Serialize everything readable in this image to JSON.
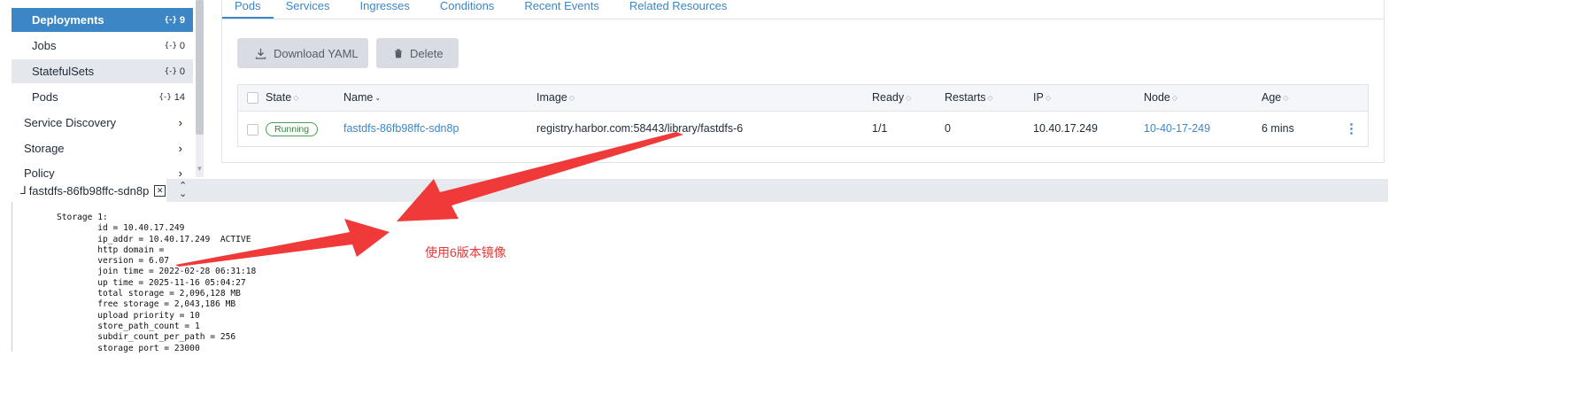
{
  "sidebar": {
    "sub_items": [
      {
        "label": "Deployments",
        "count": "9"
      },
      {
        "label": "Jobs",
        "count": "0"
      },
      {
        "label": "StatefulSets",
        "count": "0"
      },
      {
        "label": "Pods",
        "count": "14"
      }
    ],
    "groups": [
      {
        "label": "Service Discovery"
      },
      {
        "label": "Storage"
      },
      {
        "label": "Policy"
      }
    ],
    "count_icon": "{-}"
  },
  "tabs": [
    "Pods",
    "Services",
    "Ingresses",
    "Conditions",
    "Recent Events",
    "Related Resources"
  ],
  "toolbar": {
    "download_label": "Download YAML",
    "delete_label": "Delete"
  },
  "table": {
    "headers": [
      "State",
      "Name",
      "Image",
      "Ready",
      "Restarts",
      "IP",
      "Node",
      "Age"
    ],
    "rows": [
      {
        "state": "Running",
        "name": "fastdfs-86fb98ffc-sdn8p",
        "image": "registry.harbor.com:58443/library/fastdfs-6",
        "ready": "1/1",
        "restarts": "0",
        "ip": "10.40.17.249",
        "node": "10-40-17-249",
        "age": "6 mins"
      }
    ]
  },
  "terminal": {
    "tab_label": "fastdfs-86fb98ffc-sdn8p",
    "lines": [
      "Storage 1:",
      "        id = 10.40.17.249",
      "        ip_addr = 10.40.17.249  ACTIVE",
      "        http domain =",
      "        version = 6.07",
      "        join time = 2022-02-28 06:31:18",
      "        up time = 2025-11-16 05:04:27",
      "        total storage = 2,096,128 MB",
      "        free storage = 2,043,186 MB",
      "        upload priority = 10",
      "        store_path_count = 1",
      "        subdir_count_per_path = 256",
      "        storage port = 23000"
    ]
  },
  "annotation": {
    "text": "使用6版本镜像",
    "color": "#f03a3a"
  },
  "colors": {
    "accent": "#3d86c6",
    "running": "#4a9c58",
    "arrow": "#f03a3a"
  },
  "icons": [
    "download-icon",
    "trash-icon",
    "chevron-right-icon",
    "sort-icon",
    "kebab-menu-icon",
    "terminal-icon",
    "close-icon",
    "expand-toggle-icon"
  ]
}
